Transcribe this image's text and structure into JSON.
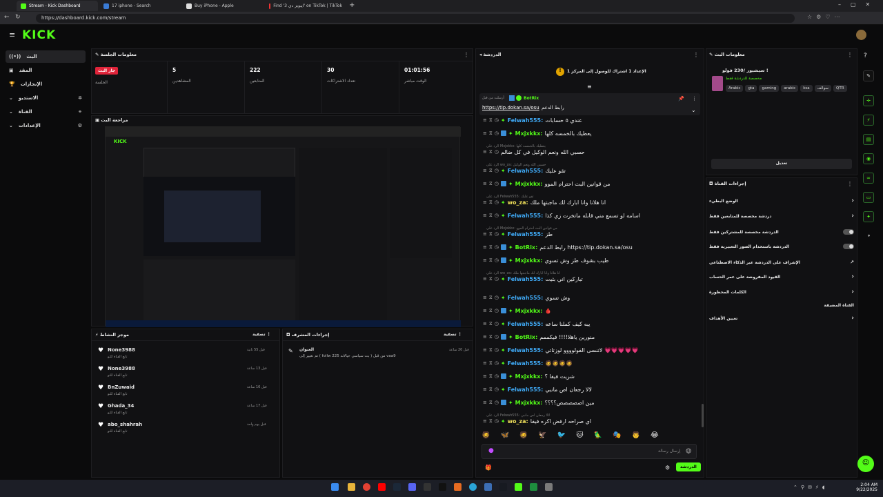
{
  "browser": {
    "tabs": [
      "Stream - Kick Dashboard",
      "17 iphone - Search",
      "Buy iPhone - Apple",
      "Find '3 ايبوبز دي' on TikTok | TikTok"
    ],
    "url": "https://dashboard.kick.com/stream"
  },
  "app": {
    "logo": "KICK"
  },
  "nav": [
    {
      "label": "البث"
    },
    {
      "label": "المقد"
    },
    {
      "label": "الإنجازات"
    },
    {
      "label": "الاستديو"
    },
    {
      "label": "القناة"
    },
    {
      "label": "الإعدادات"
    }
  ],
  "session": {
    "title": "معلومات الجلسة",
    "live_badge": "جار البث",
    "stats": [
      {
        "value": "",
        "label": "الجلسة"
      },
      {
        "value": "5",
        "label": "المشاهدين"
      },
      {
        "value": "222",
        "label": "المتابعين"
      },
      {
        "value": "30",
        "label": "تعداد الاشتراكات"
      },
      {
        "value": "01:01:56",
        "label": "الوقت مباشر"
      }
    ]
  },
  "preview": {
    "title": "مراجعة البث"
  },
  "activity": {
    "title": "موجز النشاط",
    "filter": "تصفية",
    "items": [
      {
        "name": "None3988",
        "sub": "تابع القناة للتو",
        "time": "قبل 55 ثانية"
      },
      {
        "name": "None3988",
        "sub": "تابع القناة للتو",
        "time": "قبل 13 ساعة"
      },
      {
        "name": "BnZuwaid",
        "sub": "تابع القناة للتو",
        "time": "قبل 16 ساعة"
      },
      {
        "name": "Ghada_34",
        "sub": "تابع القناة للتو",
        "time": "قبل 17 ساعة"
      },
      {
        "name": "abo_shahrah",
        "sub": "تابع القناة للتو",
        "time": "قبل يوم واحد"
      }
    ]
  },
  "modactions": {
    "title": "إجراءات المشرف",
    "filter": "تصفية",
    "item_title": "العنوان",
    "item_text": "vaa9 من قبل ( بث سياسي حيالاند 225 follw ) تم تغيير إلى",
    "item_time": "قبل 20 ساعة"
  },
  "chat": {
    "title": "الدردشة",
    "goal": "الإعداد 1 اشتراك للوصول إلى المركز 1",
    "pinned_by": "BotRix",
    "pinned_label": "أرسلت من قبل",
    "pinned_text": "رابط الدعم",
    "pinned_link": "https://tip.dokan.sa/osu",
    "messages": [
      {
        "reply": "",
        "user": "Felwah555",
        "color": "#3fa9f5",
        "text": "عندي ٥ حسابات"
      },
      {
        "reply": "",
        "user": "Mxjxkkx",
        "color": "#53fc18",
        "text": "يعطيك بالخمسه كلها"
      },
      {
        "reply": "الرد على Mxjxkkx: يعطيك بالخمسه كلها",
        "user": "",
        "color": "",
        "text": "حسبي الله ونعم الوكيل في كل ضالم"
      },
      {
        "reply": "الرد على wo_za: حسبي الله ونعم الوكيل",
        "user": "Felwah555",
        "color": "#3fa9f5",
        "text": "تقو عليك"
      },
      {
        "reply": "",
        "user": "Mxjxkkx",
        "color": "#53fc18",
        "text": "من قوانين البث احترام الموو"
      },
      {
        "reply": "الرد على Felwah555: تقو عليك",
        "user": "wo_za",
        "color": "#f0e05a",
        "text": "انا هلانا وانا ابارك لك ماجبتها ملك"
      },
      {
        "reply": "",
        "user": "Felwah555",
        "color": "#3fa9f5",
        "text": "اسامه لو تسمع مني قابله ماتخرت زي كذا"
      },
      {
        "reply": "الرد على Mxjxkkx: من قوانين البث احترام الموو",
        "user": "Felwah555",
        "color": "#3fa9f5",
        "text": "طز"
      },
      {
        "reply": "",
        "user": "BotRix",
        "color": "#53fc18",
        "text": "رابط الدعم https://tip.dokan.sa/osu"
      },
      {
        "reply": "",
        "user": "Mxjxkkx",
        "color": "#53fc18",
        "text": "طيب بشوف طز وش تسوي"
      },
      {
        "reply": "الرد على wo_za: انا هلانا وانا ابارك لك ماجبتها ملك",
        "user": "Felwah555",
        "color": "#3fa9f5",
        "text": "تباركين اني بثيت"
      },
      {
        "reply": "",
        "user": "Felwah555",
        "color": "#3fa9f5",
        "text": "وش تسوي"
      },
      {
        "reply": "",
        "user": "Mxjxkkx",
        "color": "#53fc18",
        "text": "🩸"
      },
      {
        "reply": "",
        "user": "Felwah555",
        "color": "#3fa9f5",
        "text": "يبه كيف كملنا ساعه"
      },
      {
        "reply": "",
        "user": "BotRix",
        "color": "#53fc18",
        "text": "منورين ياهلا!!!! فيكممم"
      },
      {
        "reply": "",
        "user": "Felwah555",
        "color": "#3fa9f5",
        "text": "لاتنسى الفولوووو لوزتاتي 💗💗💗💗💗"
      },
      {
        "reply": "",
        "user": "Felwah555",
        "color": "#3fa9f5",
        "text": "🧔🧔🧔🧔"
      },
      {
        "reply": "",
        "user": "Mxjxkkx",
        "color": "#53fc18",
        "text": "شريت فيفا ؟"
      },
      {
        "reply": "",
        "user": "Felwah555",
        "color": "#3fa9f5",
        "text": "لالا رجعان اص مانبي"
      },
      {
        "reply": "",
        "user": "Mxjxkkx",
        "color": "#53fc18",
        "text": "مين اصصصصص؟؟؟؟"
      },
      {
        "reply": "الرد على Felwah555: لالا رجعان اص مانبي",
        "user": "wo_za",
        "color": "#f0e05a",
        "text": "اي صراحه ارفض اكره فيفا"
      }
    ],
    "input_placeholder": "إرسال رسالة",
    "send_label": "الدردشة"
  },
  "streaminfo": {
    "title": "معلومات البث",
    "stream_title": "سيشيور /230 فولو !",
    "category": "مخصصة للدردشة فقط",
    "tags": [
      "Arabic",
      "gta",
      "gaming",
      "arabic",
      "ksa",
      "سوالف",
      "QTR"
    ],
    "edit_label": "تعديل"
  },
  "channelactions": {
    "title": "إجراءات القناة",
    "rows": [
      {
        "label": "الوضع البطيء",
        "ctrl": "chevron"
      },
      {
        "label": "دردشة مخصصة للمتابعين فقط",
        "ctrl": "chevron"
      },
      {
        "label": "الدردشة مخصصة للمشتركين فقط",
        "ctrl": "toggle"
      },
      {
        "label": "الدردشة باستخدام الصور التعبيرية فقط",
        "ctrl": "toggle"
      },
      {
        "label": "الإشراف على الدردشة عبر الذكاء الاصطناعي",
        "ctrl": "external"
      },
      {
        "label": "القيود المفروضة على عمر الحساب",
        "ctrl": "chevron"
      },
      {
        "label": "الكلمات المحظورة",
        "ctrl": "chevron"
      },
      {
        "label": "القناة المضيفة",
        "ctrl": "none"
      },
      {
        "label": "تعيين الأهداف",
        "ctrl": "chevron"
      }
    ]
  },
  "taskbar": {
    "time": "2:04 AM",
    "date": "9/22/2025"
  },
  "colors": {
    "accent": "#53fc18",
    "live": "#e0243a",
    "bg": "#0b0b0c",
    "panel": "#111113"
  }
}
